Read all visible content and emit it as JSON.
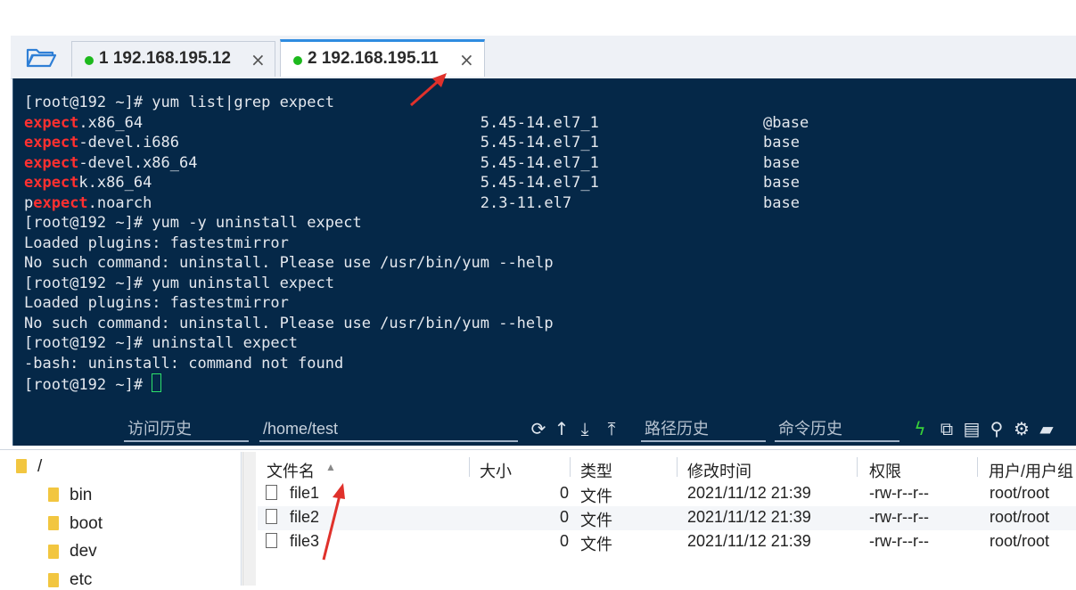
{
  "tabs": [
    {
      "label": "1 192.168.195.12",
      "close": "×",
      "active": false
    },
    {
      "label": "2 192.168.195.11",
      "close": "×",
      "active": true
    }
  ],
  "terminal": {
    "lines": [
      {
        "segments": [
          {
            "t": "[root@192 ~]# yum list|grep expect"
          }
        ]
      },
      {
        "segments": [
          {
            "t": "expect",
            "red": true
          },
          {
            "t": ".x86_64                                     5.45-14.el7_1                  @base"
          }
        ]
      },
      {
        "segments": [
          {
            "t": "expect",
            "red": true
          },
          {
            "t": "-devel.i686                                 5.45-14.el7_1                  base"
          }
        ]
      },
      {
        "segments": [
          {
            "t": "expect",
            "red": true
          },
          {
            "t": "-devel.x86_64                               5.45-14.el7_1                  base"
          }
        ]
      },
      {
        "segments": [
          {
            "t": "expect",
            "red": true
          },
          {
            "t": "k.x86_64                                    5.45-14.el7_1                  base"
          }
        ]
      },
      {
        "segments": [
          {
            "t": "p"
          },
          {
            "t": "expect",
            "red": true
          },
          {
            "t": ".noarch                                    2.3-11.el7                     base"
          }
        ]
      },
      {
        "segments": [
          {
            "t": "[root@192 ~]# yum -y uninstall expect"
          }
        ]
      },
      {
        "segments": [
          {
            "t": "Loaded plugins: fastestmirror"
          }
        ]
      },
      {
        "segments": [
          {
            "t": "No such command: uninstall. Please use /usr/bin/yum --help"
          }
        ]
      },
      {
        "segments": [
          {
            "t": "[root@192 ~]# yum uninstall expect"
          }
        ]
      },
      {
        "segments": [
          {
            "t": "Loaded plugins: fastestmirror"
          }
        ]
      },
      {
        "segments": [
          {
            "t": "No such command: uninstall. Please use /usr/bin/yum --help"
          }
        ]
      },
      {
        "segments": [
          {
            "t": "[root@192 ~]# uninstall expect"
          }
        ]
      },
      {
        "segments": [
          {
            "t": "-bash: uninstall: command not found"
          }
        ]
      },
      {
        "segments": [
          {
            "t": "[root@192 ~]# "
          }
        ],
        "cursor": true
      }
    ],
    "colors": {
      "background": "#052848",
      "text": "#e4e8ee",
      "highlight": "#ff3030",
      "cursor": "#2ee16b"
    }
  },
  "toolbar": {
    "history_placeholder": "访问历史",
    "path_value": "/home/test",
    "path_history": "路径历史",
    "command_history": "命令历史",
    "icons": [
      "refresh-icon",
      "upload-arrow-icon",
      "download-icon",
      "upload-icon",
      "flash-icon",
      "copy-icon",
      "paste-icon",
      "search-icon",
      "gear-icon",
      "folder-icon"
    ]
  },
  "tree": {
    "root": "/",
    "items": [
      "bin",
      "boot",
      "dev",
      "etc"
    ]
  },
  "files": {
    "columns": [
      "文件名",
      "大小",
      "类型",
      "修改时间",
      "权限",
      "用户/用户组"
    ],
    "rows": [
      {
        "name": "file1",
        "size": "0",
        "type": "文件",
        "mtime": "2021/11/12 21:39",
        "perm": "-rw-r--r--",
        "owner": "root/root"
      },
      {
        "name": "file2",
        "size": "0",
        "type": "文件",
        "mtime": "2021/11/12 21:39",
        "perm": "-rw-r--r--",
        "owner": "root/root"
      },
      {
        "name": "file3",
        "size": "0",
        "type": "文件",
        "mtime": "2021/11/12 21:39",
        "perm": "-rw-r--r--",
        "owner": "root/root"
      }
    ]
  }
}
